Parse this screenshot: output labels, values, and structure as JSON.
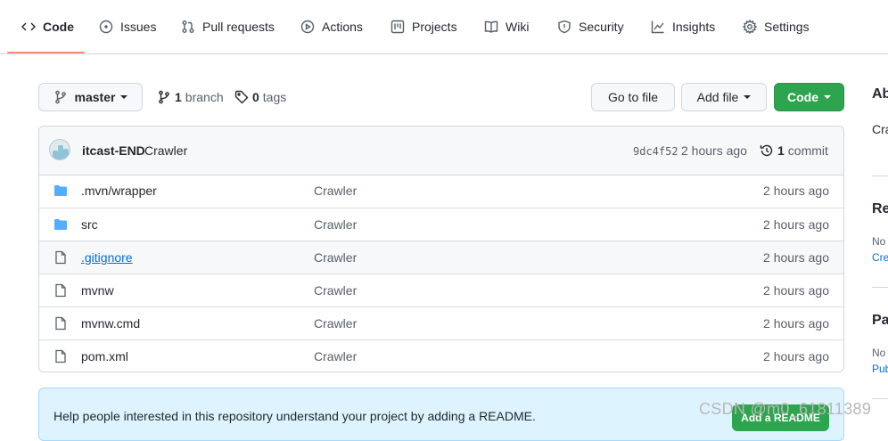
{
  "tabs": [
    {
      "label": "Code",
      "icon": "code-icon",
      "active": true
    },
    {
      "label": "Issues",
      "icon": "issue-icon"
    },
    {
      "label": "Pull requests",
      "icon": "pull-request-icon"
    },
    {
      "label": "Actions",
      "icon": "play-icon"
    },
    {
      "label": "Projects",
      "icon": "project-icon"
    },
    {
      "label": "Wiki",
      "icon": "book-icon"
    },
    {
      "label": "Security",
      "icon": "shield-icon"
    },
    {
      "label": "Insights",
      "icon": "graph-icon"
    },
    {
      "label": "Settings",
      "icon": "gear-icon"
    }
  ],
  "toolbar": {
    "branch_label": "master",
    "branch_count": "1",
    "branch_word": "branch",
    "tag_count": "0",
    "tag_word": "tags",
    "go_to_file": "Go to file",
    "add_file": "Add file",
    "code_button": "Code"
  },
  "commit": {
    "author": "itcast-END",
    "message": "Crawler",
    "sha": "9dc4f52",
    "time": "2 hours ago",
    "count": "1",
    "count_word": "commit"
  },
  "files": [
    {
      "name": ".mvn/wrapper",
      "type": "folder",
      "message": "Crawler",
      "age": "2 hours ago"
    },
    {
      "name": "src",
      "type": "folder",
      "message": "Crawler",
      "age": "2 hours ago"
    },
    {
      "name": ".gitignore",
      "type": "file",
      "message": "Crawler",
      "age": "2 hours ago"
    },
    {
      "name": "mvnw",
      "type": "file",
      "message": "Crawler",
      "age": "2 hours ago"
    },
    {
      "name": "mvnw.cmd",
      "type": "file",
      "message": "Crawler",
      "age": "2 hours ago"
    },
    {
      "name": "pom.xml",
      "type": "file",
      "message": "Crawler",
      "age": "2 hours ago"
    }
  ],
  "readme": {
    "text": "Help people interested in this repository understand your project by adding a README.",
    "button": "Add a README"
  },
  "sidebar": {
    "about_heading": "Ab",
    "about_text": "Cra",
    "releases_heading": "Re",
    "releases_text": "No",
    "releases_link": "Cre",
    "packages_heading": "Pa",
    "packages_text": "No",
    "packages_link": "Pub"
  },
  "watermark": "CSDN @m0_61811389",
  "colors": {
    "accent": "#fd8c73",
    "green": "#2da44e",
    "link": "#0969da",
    "folder": "#54aeff"
  }
}
